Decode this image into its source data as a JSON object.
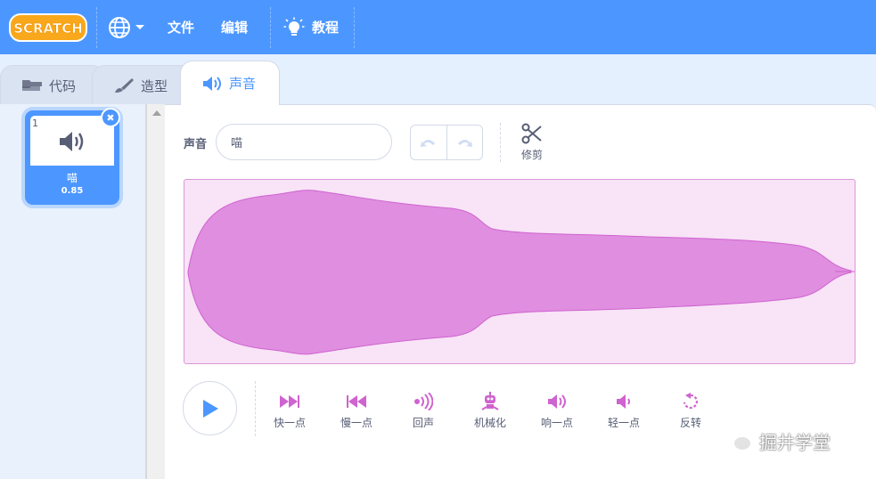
{
  "menubar": {
    "logo_text": "SCRATCH",
    "file_label": "文件",
    "edit_label": "编辑",
    "tutorials_label": "教程",
    "bg_color": "#4c97ff"
  },
  "tabs": {
    "code_label": "代码",
    "costumes_label": "造型",
    "sounds_label": "声音"
  },
  "sound_list": [
    {
      "number": "1",
      "name": "喵",
      "duration": "0.85"
    }
  ],
  "editor": {
    "sound_label": "声音",
    "sound_name": "喵",
    "trim_label": "修剪"
  },
  "effects": [
    {
      "label": "快一点",
      "icon": "faster-icon"
    },
    {
      "label": "慢一点",
      "icon": "slower-icon"
    },
    {
      "label": "回声",
      "icon": "echo-icon"
    },
    {
      "label": "机械化",
      "icon": "robot-icon"
    },
    {
      "label": "响一点",
      "icon": "louder-icon"
    },
    {
      "label": "轻一点",
      "icon": "softer-icon"
    },
    {
      "label": "反转",
      "icon": "reverse-icon"
    }
  ],
  "watermark": {
    "text": "掘井学堂"
  },
  "colors": {
    "accent": "#4c97ff",
    "effect": "#cf63cf",
    "wave_fill": "#e08ee0"
  }
}
